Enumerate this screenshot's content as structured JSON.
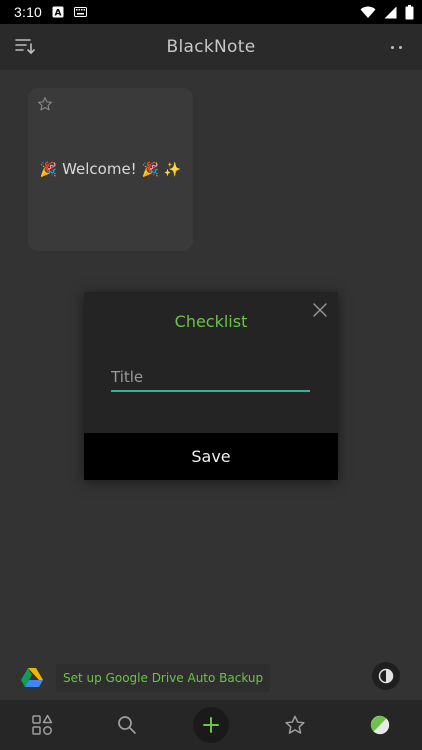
{
  "status_bar": {
    "time": "3:10",
    "icons": [
      "a-notification-icon",
      "keyboard-icon",
      "wifi-icon",
      "signal-icon",
      "battery-icon"
    ]
  },
  "app_bar": {
    "title": "BlackNote",
    "left_icon": "sort-icon",
    "right_icon": "more-icon"
  },
  "notes": [
    {
      "text": "Welcome!",
      "emoji_left": "🎉",
      "emoji_right": "🎉",
      "sparkle": "✨",
      "starred": false
    }
  ],
  "dialog": {
    "title": "Checklist",
    "input_placeholder": "Title",
    "input_value": "",
    "save_label": "Save",
    "close_icon": "close-icon"
  },
  "backup": {
    "label": "Set up Google Drive Auto Backup",
    "icon": "google-drive-icon"
  },
  "bottom_nav": [
    {
      "name": "categories",
      "icon": "categories-icon"
    },
    {
      "name": "search",
      "icon": "search-icon"
    },
    {
      "name": "add",
      "icon": "plus-icon"
    },
    {
      "name": "favorites",
      "icon": "star-icon"
    },
    {
      "name": "theme",
      "icon": "palette-icon"
    }
  ],
  "colors": {
    "accent_green": "#6cc348",
    "input_underline": "#2fb39a",
    "background": "#333333",
    "dialog_bg": "#242424"
  }
}
